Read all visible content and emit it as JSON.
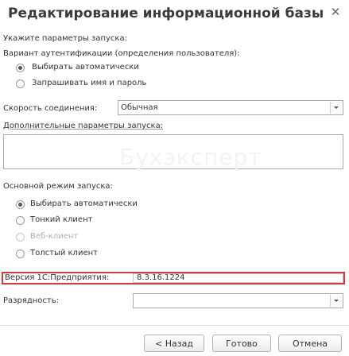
{
  "window": {
    "title": "Редактирование информационной базы",
    "close_glyph": "✕"
  },
  "launch_params": {
    "heading": "Укажите параметры запуска:",
    "auth_heading": "Вариант аутентификации (определения пользователя):",
    "auth_options": [
      {
        "label": "Выбирать автоматически",
        "selected": true
      },
      {
        "label": "Запрашивать имя и пароль",
        "selected": false
      }
    ],
    "speed_label": "Скорость соединения:",
    "speed_value": "Обычная",
    "extra_label": "Дополнительные параметры запуска:",
    "extra_value": ""
  },
  "watermark": "Бухэксперт",
  "mode": {
    "heading": "Основной режим запуска:",
    "options": [
      {
        "label": "Выбирать автоматически",
        "selected": true,
        "enabled": true
      },
      {
        "label": "Тонкий клиент",
        "selected": false,
        "enabled": true
      },
      {
        "label": "Веб-клиент",
        "selected": false,
        "enabled": false
      },
      {
        "label": "Толстый клиент",
        "selected": false,
        "enabled": true
      }
    ]
  },
  "version": {
    "label": "Версия 1С:Предприятия:",
    "value": "8.3.16.1224"
  },
  "bitness": {
    "label": "Разрядность:",
    "value": ""
  },
  "buttons": {
    "back": "< Назад",
    "done": "Готово",
    "cancel": "Отмена"
  },
  "colors": {
    "highlight_border": "#d53a3a"
  }
}
